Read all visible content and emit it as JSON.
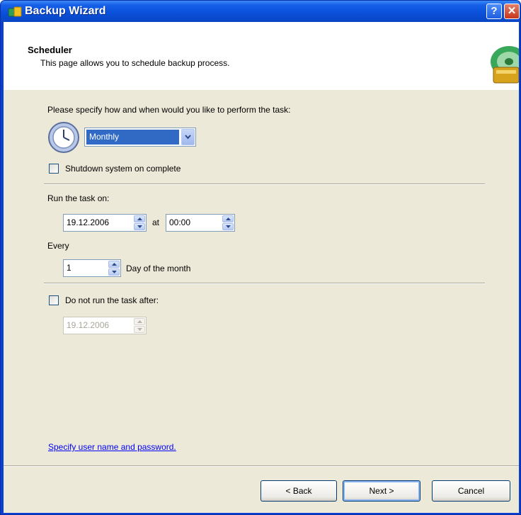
{
  "window": {
    "title": "Backup Wizard",
    "help_glyph": "?",
    "close_glyph": "✕"
  },
  "header": {
    "title": "Scheduler",
    "description": "This page allows you to schedule backup process."
  },
  "main": {
    "prompt": "Please specify how and when would you like to perform the task:",
    "frequency": {
      "value": "Monthly"
    },
    "shutdown": {
      "label": "Shutdown system on complete",
      "checked": false
    },
    "run_task_label": "Run the task on:",
    "run_date": "19.12.2006",
    "at_label": "at",
    "run_time": "00:00",
    "every_label": "Every",
    "every_value": "1",
    "every_unit": "Day of the month",
    "not_after": {
      "label": "Do not run the task after:",
      "checked": false,
      "date": "19.12.2006"
    },
    "credentials_link": "Specify user name and password."
  },
  "footer": {
    "back_label": "< Back",
    "next_label": "Next >",
    "cancel_label": "Cancel"
  },
  "colors": {
    "titlebar": "#0a4fd9",
    "dialog_bg": "#ece9d8",
    "selection": "#316ac5",
    "link": "#0000ff"
  },
  "icons": [
    "app-icon",
    "help-icon",
    "close-icon",
    "backup-graphic-icon",
    "clock-icon",
    "chevron-down-icon",
    "spin-up-icon",
    "spin-down-icon"
  ]
}
